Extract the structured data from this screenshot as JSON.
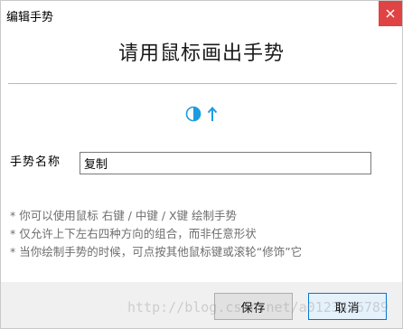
{
  "window": {
    "title": "编辑手势",
    "close_icon": "close-icon"
  },
  "heading": "请用鼠标画出手势",
  "gesture": {
    "icons": [
      "half-circle-icon",
      "arrow-up-icon"
    ],
    "color": "#1c9ce0"
  },
  "form": {
    "name_label": "手势名称",
    "name_value": "复制"
  },
  "hints": [
    "* 你可以使用鼠标 右键 / 中键 / X键 绘制手势",
    "* 仅允许上下左右四种方向的组合，而非任意形状",
    "* 当你绘制手势的时候，可点按其他鼠标键或滚轮“修饰”它"
  ],
  "buttons": {
    "save": "保存",
    "cancel": "取消"
  },
  "watermark": "http://blog.csdn.net/a0123456789"
}
